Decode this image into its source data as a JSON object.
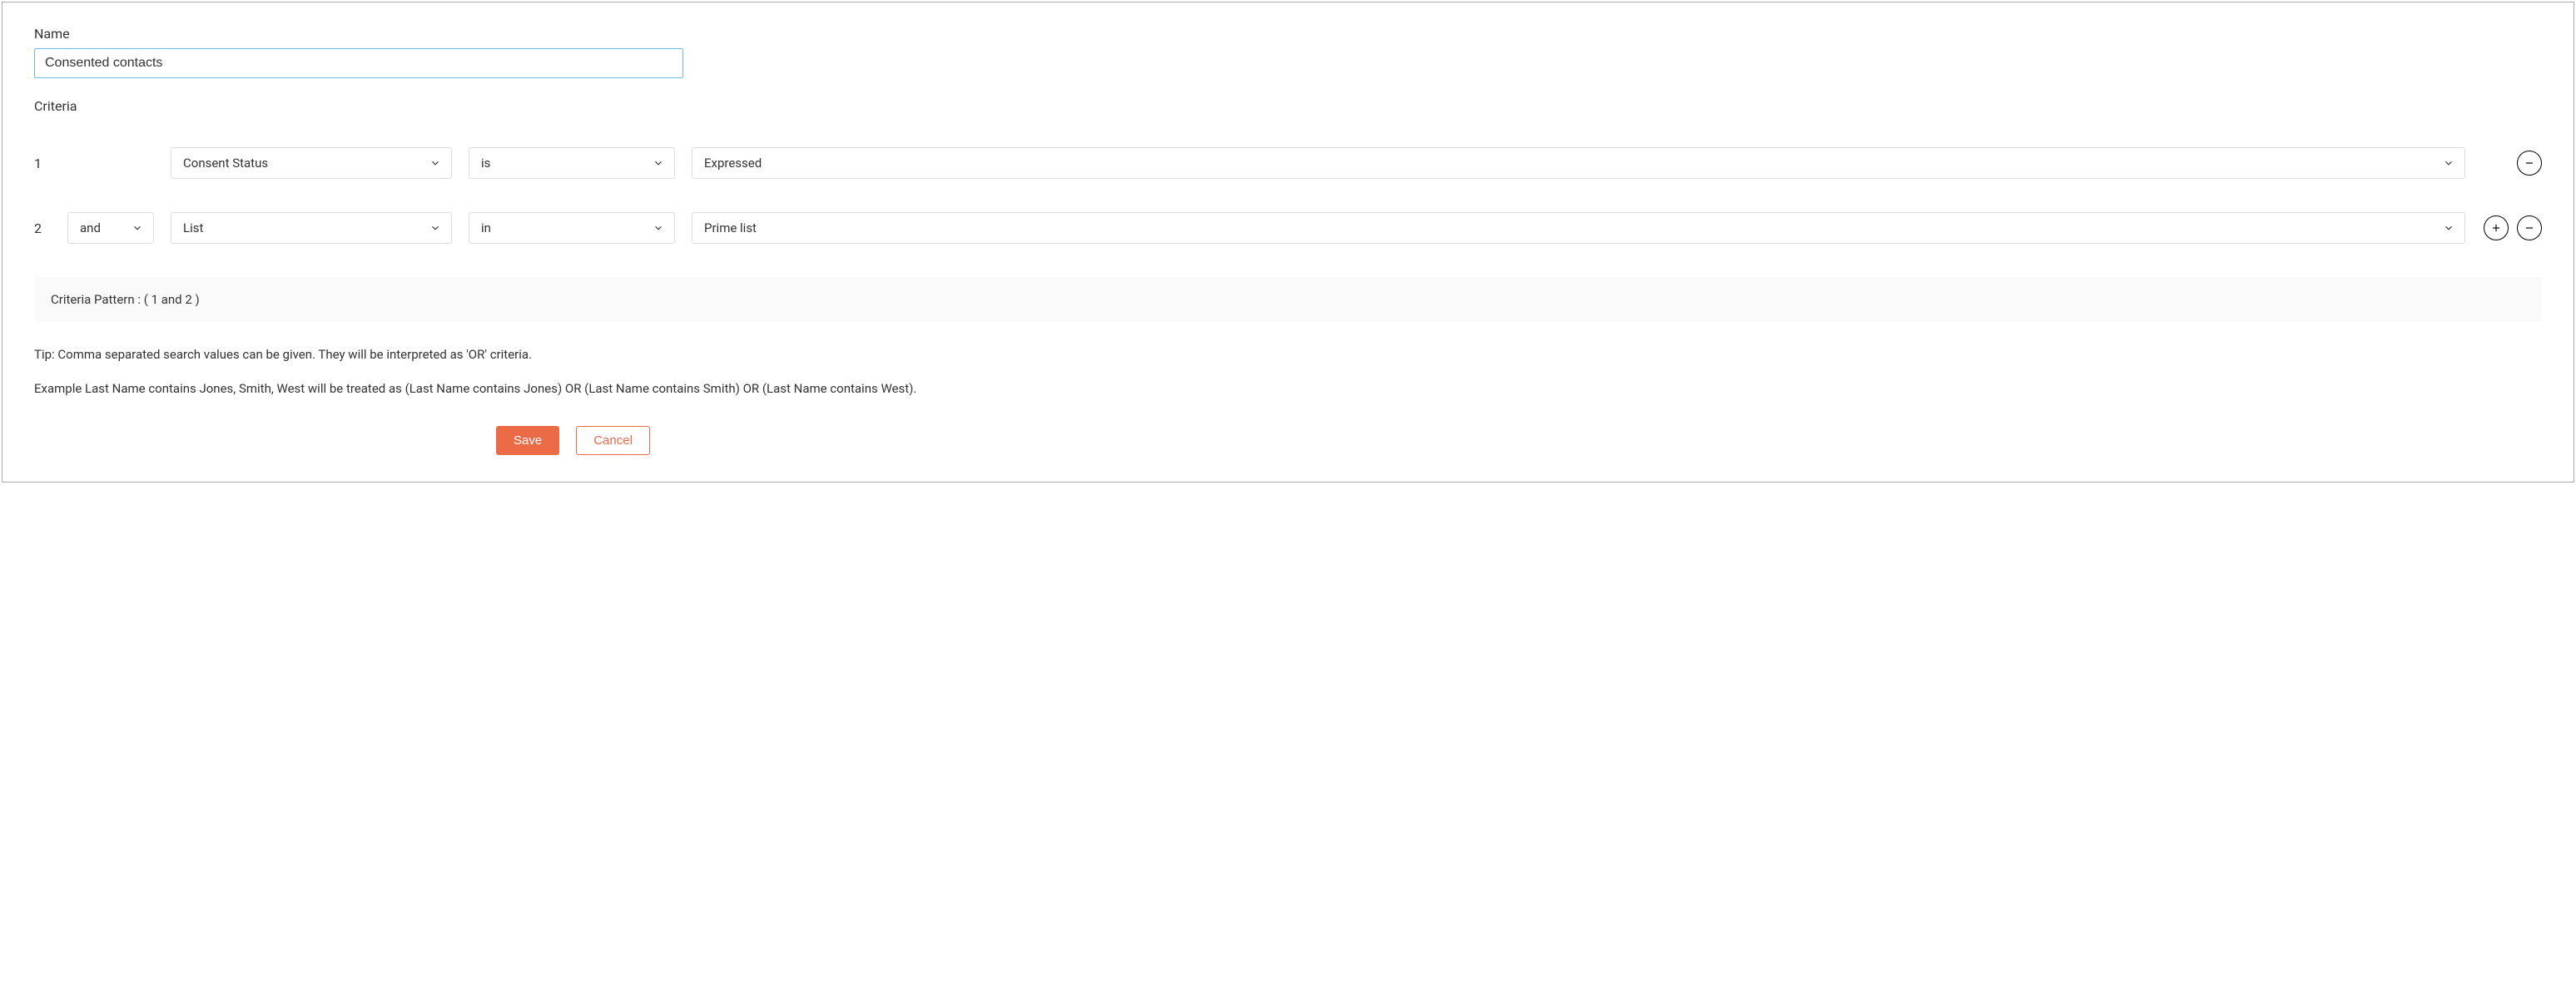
{
  "labels": {
    "name": "Name",
    "criteria": "Criteria"
  },
  "name_value": "Consented contacts",
  "rows": [
    {
      "number": "1",
      "logic": null,
      "field": "Consent Status",
      "operator": "is",
      "value": "Expressed",
      "show_add": false,
      "show_remove": true
    },
    {
      "number": "2",
      "logic": "and",
      "field": "List",
      "operator": "in",
      "value": "Prime list",
      "show_add": true,
      "show_remove": true
    }
  ],
  "pattern_label": "Criteria Pattern :",
  "pattern_value": "( 1 and 2 )",
  "tip": "Tip: Comma separated search values can be given. They will be interpreted as 'OR' criteria.",
  "example": "Example  Last Name contains Jones, Smith, West will be treated as (Last Name contains Jones) OR (Last Name contains Smith) OR (Last Name contains West).",
  "buttons": {
    "save": "Save",
    "cancel": "Cancel"
  }
}
